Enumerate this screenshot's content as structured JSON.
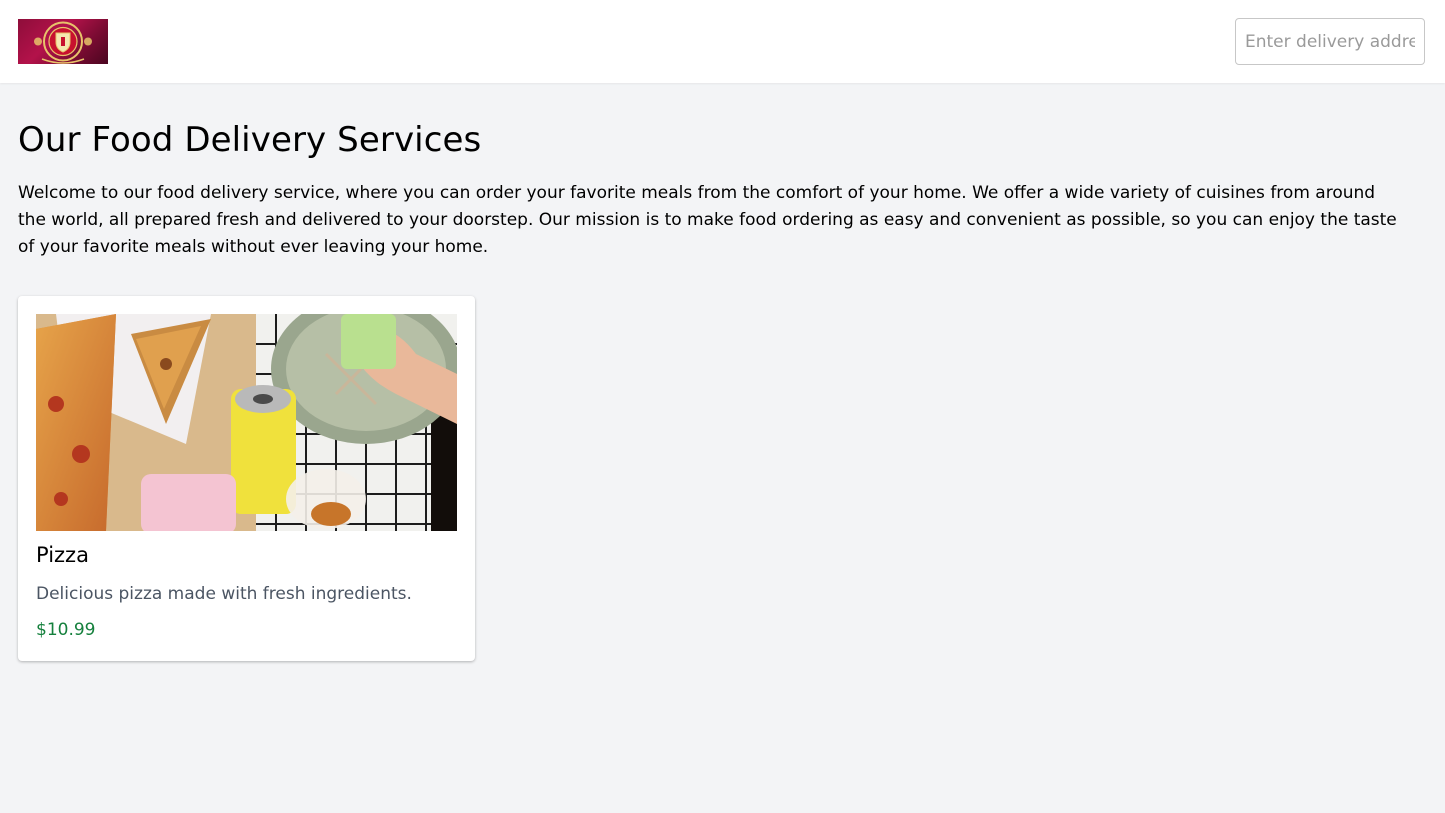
{
  "header": {
    "logo_alt": "Manchester United",
    "search_placeholder": "Enter delivery address"
  },
  "main": {
    "title": "Our Food Delivery Services",
    "intro": "Welcome to our food delivery service, where you can order your favorite meals from the comfort of your home. We offer a wide variety of cuisines from around the world, all prepared fresh and delivered to your doorstep. Our mission is to make food ordering as easy and convenient as possible, so you can enjoy the taste of your favorite meals without ever leaving your home."
  },
  "menu_items": [
    {
      "name": "Pizza",
      "description": "Delicious pizza made with fresh ingredients.",
      "price": "$10.99"
    }
  ],
  "colors": {
    "page_background": "#f3f4f6",
    "price_accent": "#15803d",
    "logo_red": "#b3124a"
  }
}
